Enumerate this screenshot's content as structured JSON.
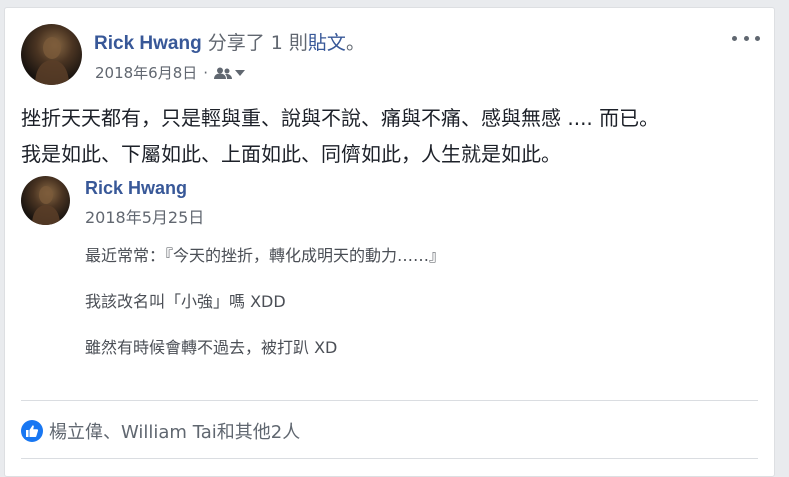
{
  "post": {
    "author": "Rick Hwang",
    "action_prefix": "分享了 1 則",
    "action_link": "貼文",
    "action_suffix": "。",
    "date": "2018年6月8日",
    "audience_icon": "friends-icon",
    "more_icon": "more-horizontal-icon",
    "text_lines": [
      "挫折天天都有，只是輕與重、說與不說、痛與不痛、感與無感 .... 而已。",
      "我是如此、下屬如此、上面如此、同儕如此，人生就是如此。"
    ]
  },
  "shared_post": {
    "author": "Rick Hwang",
    "date": "2018年5月25日",
    "lines": [
      "最近常常：『今天的挫折，轉化成明天的動力……』",
      "我該改名叫「小強」嗎 XDD",
      "雖然有時候會轉不過去，被打趴 XD"
    ]
  },
  "reactions": {
    "icon": "like-icon",
    "text": "楊立偉、William Tai和其他2人"
  },
  "colors": {
    "link": "#385898",
    "like": "#1877f2",
    "meta": "#616770"
  }
}
